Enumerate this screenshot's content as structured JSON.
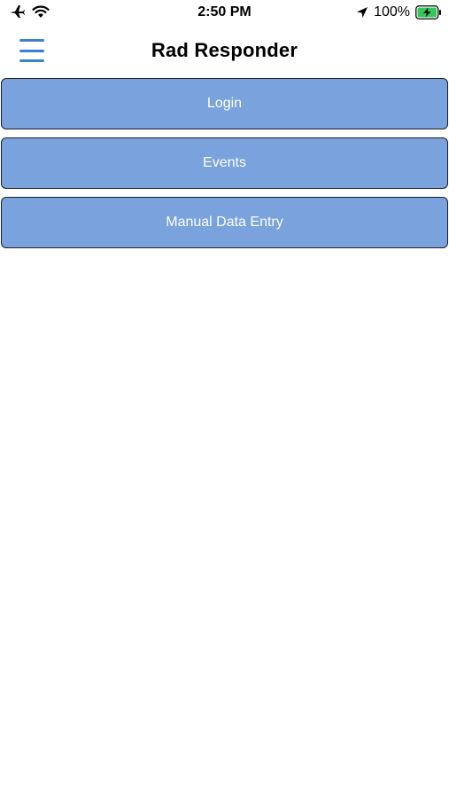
{
  "status_bar": {
    "time": "2:50 PM",
    "battery": "100%",
    "icons": {
      "airplane": "airplane-icon",
      "wifi": "wifi-icon",
      "location": "location-arrow-icon",
      "battery": "battery-charging-icon"
    },
    "battery_color": "#34c759"
  },
  "header": {
    "title": "Rad Responder",
    "menu_icon": "hamburger-menu-icon",
    "accent": "#3a7fd9"
  },
  "nav": {
    "button_color": "#7aa2dd",
    "items": [
      {
        "label": "Login"
      },
      {
        "label": "Events"
      },
      {
        "label": "Manual Data Entry"
      }
    ]
  }
}
